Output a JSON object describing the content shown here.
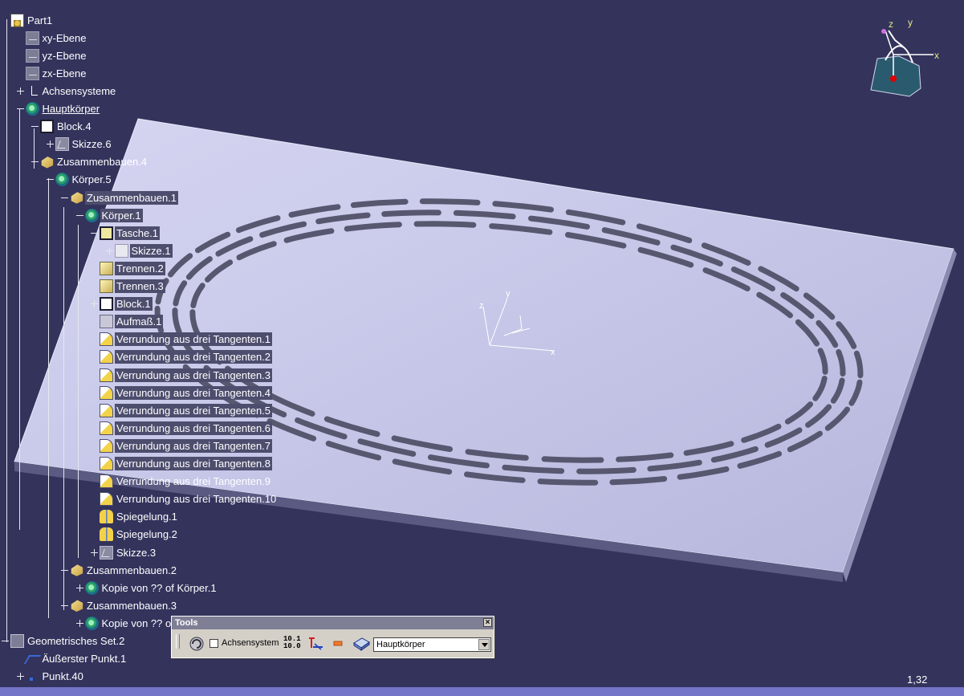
{
  "tree": {
    "nodes": [
      {
        "label": "Part1",
        "icon": "document-icon",
        "depth": 0,
        "expander": "none",
        "selected": false
      },
      {
        "label": "xy-Ebene",
        "icon": "plane-icon",
        "depth": 1,
        "expander": "none",
        "selected": false
      },
      {
        "label": "yz-Ebene",
        "icon": "plane-icon",
        "depth": 1,
        "expander": "none",
        "selected": false
      },
      {
        "label": "zx-Ebene",
        "icon": "plane-icon",
        "depth": 1,
        "expander": "none",
        "selected": false
      },
      {
        "label": "Achsensysteme",
        "icon": "axis-system-icon",
        "depth": 1,
        "expander": "plus",
        "selected": false
      },
      {
        "label": "Hauptkörper",
        "icon": "body-icon",
        "depth": 1,
        "expander": "minus",
        "selected": false,
        "underline": true
      },
      {
        "label": "Block.4",
        "icon": "pad-icon",
        "depth": 2,
        "expander": "minus",
        "selected": false
      },
      {
        "label": "Skizze.6",
        "icon": "sketch-icon",
        "depth": 3,
        "expander": "plus",
        "selected": false
      },
      {
        "label": "Zusammenbauen.4",
        "icon": "assemble-icon",
        "depth": 2,
        "expander": "minus",
        "selected": false
      },
      {
        "label": "Körper.5",
        "icon": "body-icon",
        "depth": 3,
        "expander": "minus",
        "selected": false
      },
      {
        "label": "Zusammenbauen.1",
        "icon": "assemble-icon",
        "depth": 4,
        "expander": "minus",
        "selected": true
      },
      {
        "label": "Körper.1",
        "icon": "body-icon",
        "depth": 5,
        "expander": "minus",
        "selected": true
      },
      {
        "label": "Tasche.1",
        "icon": "pocket-icon",
        "depth": 6,
        "expander": "minus",
        "selected": true
      },
      {
        "label": "Skizze.1",
        "icon": "sketch-white-icon",
        "depth": 7,
        "expander": "plus",
        "selected": true
      },
      {
        "label": "Trennen.2",
        "icon": "split-icon",
        "depth": 6,
        "expander": "none",
        "selected": true
      },
      {
        "label": "Trennen.3",
        "icon": "split-icon",
        "depth": 6,
        "expander": "none",
        "selected": true
      },
      {
        "label": "Block.1",
        "icon": "pad-icon",
        "depth": 6,
        "expander": "plus",
        "selected": true
      },
      {
        "label": "Aufmaß.1",
        "icon": "thickness-icon",
        "depth": 6,
        "expander": "none",
        "selected": true
      },
      {
        "label": "Verrundung aus drei Tangenten.1",
        "icon": "fillet-icon",
        "depth": 6,
        "expander": "none",
        "selected": true
      },
      {
        "label": "Verrundung aus drei Tangenten.2",
        "icon": "fillet-icon",
        "depth": 6,
        "expander": "none",
        "selected": true
      },
      {
        "label": "Verrundung aus drei Tangenten.3",
        "icon": "fillet-icon",
        "depth": 6,
        "expander": "none",
        "selected": true
      },
      {
        "label": "Verrundung aus drei Tangenten.4",
        "icon": "fillet-icon",
        "depth": 6,
        "expander": "none",
        "selected": true
      },
      {
        "label": "Verrundung aus drei Tangenten.5",
        "icon": "fillet-icon",
        "depth": 6,
        "expander": "none",
        "selected": true
      },
      {
        "label": "Verrundung aus drei Tangenten.6",
        "icon": "fillet-icon",
        "depth": 6,
        "expander": "none",
        "selected": true
      },
      {
        "label": "Verrundung aus drei Tangenten.7",
        "icon": "fillet-icon",
        "depth": 6,
        "expander": "none",
        "selected": true
      },
      {
        "label": "Verrundung aus drei Tangenten.8",
        "icon": "fillet-icon",
        "depth": 6,
        "expander": "none",
        "selected": true
      },
      {
        "label": "Verrundung aus drei Tangenten.9",
        "icon": "fillet-icon",
        "depth": 6,
        "expander": "none",
        "selected": false
      },
      {
        "label": "Verrundung aus drei Tangenten.10",
        "icon": "fillet-icon",
        "depth": 6,
        "expander": "none",
        "selected": false
      },
      {
        "label": "Spiegelung.1",
        "icon": "mirror-icon",
        "depth": 6,
        "expander": "none",
        "selected": false
      },
      {
        "label": "Spiegelung.2",
        "icon": "mirror-icon",
        "depth": 6,
        "expander": "none",
        "selected": false
      },
      {
        "label": "Skizze.3",
        "icon": "sketch-icon",
        "depth": 6,
        "expander": "plus",
        "selected": false
      },
      {
        "label": "Zusammenbauen.2",
        "icon": "assemble-icon",
        "depth": 4,
        "expander": "minus",
        "selected": false
      },
      {
        "label": "Kopie von ?? of Körper.1",
        "icon": "body-icon",
        "depth": 5,
        "expander": "plus",
        "selected": false
      },
      {
        "label": "Zusammenbauen.3",
        "icon": "assemble-icon",
        "depth": 4,
        "expander": "minus",
        "selected": false
      },
      {
        "label": "Kopie von ?? of",
        "icon": "body-icon",
        "depth": 5,
        "expander": "plus",
        "selected": false
      },
      {
        "label": "Geometrisches Set.2",
        "icon": "geometrical-set-icon",
        "depth": 0,
        "expander": "minus",
        "selected": false
      },
      {
        "label": "Äußerster Punkt.1",
        "icon": "curve-icon",
        "depth": 1,
        "expander": "none",
        "selected": false
      },
      {
        "label": "Punkt.40",
        "icon": "point-icon",
        "depth": 1,
        "expander": "plus",
        "selected": false
      }
    ]
  },
  "compass": {
    "x_label": "x",
    "y_label": "y",
    "z_label": "z"
  },
  "model_axes": {
    "x_label": "x",
    "y_label": "y",
    "z_label": "z"
  },
  "tools": {
    "title": "Tools",
    "close_glyph": "×",
    "axis_checkbox_label": "Achsensystem",
    "axis_checkbox_checked": false,
    "num_top": "10.1",
    "num_bottom": "10.0",
    "current_body": "Hauptkörper"
  },
  "status": {
    "zoom_text": "1,32"
  },
  "colors": {
    "background": "#33335c",
    "plate_top": "#c4c4e8",
    "slot": "#5a5a72",
    "selection": "#4d4d6e"
  }
}
